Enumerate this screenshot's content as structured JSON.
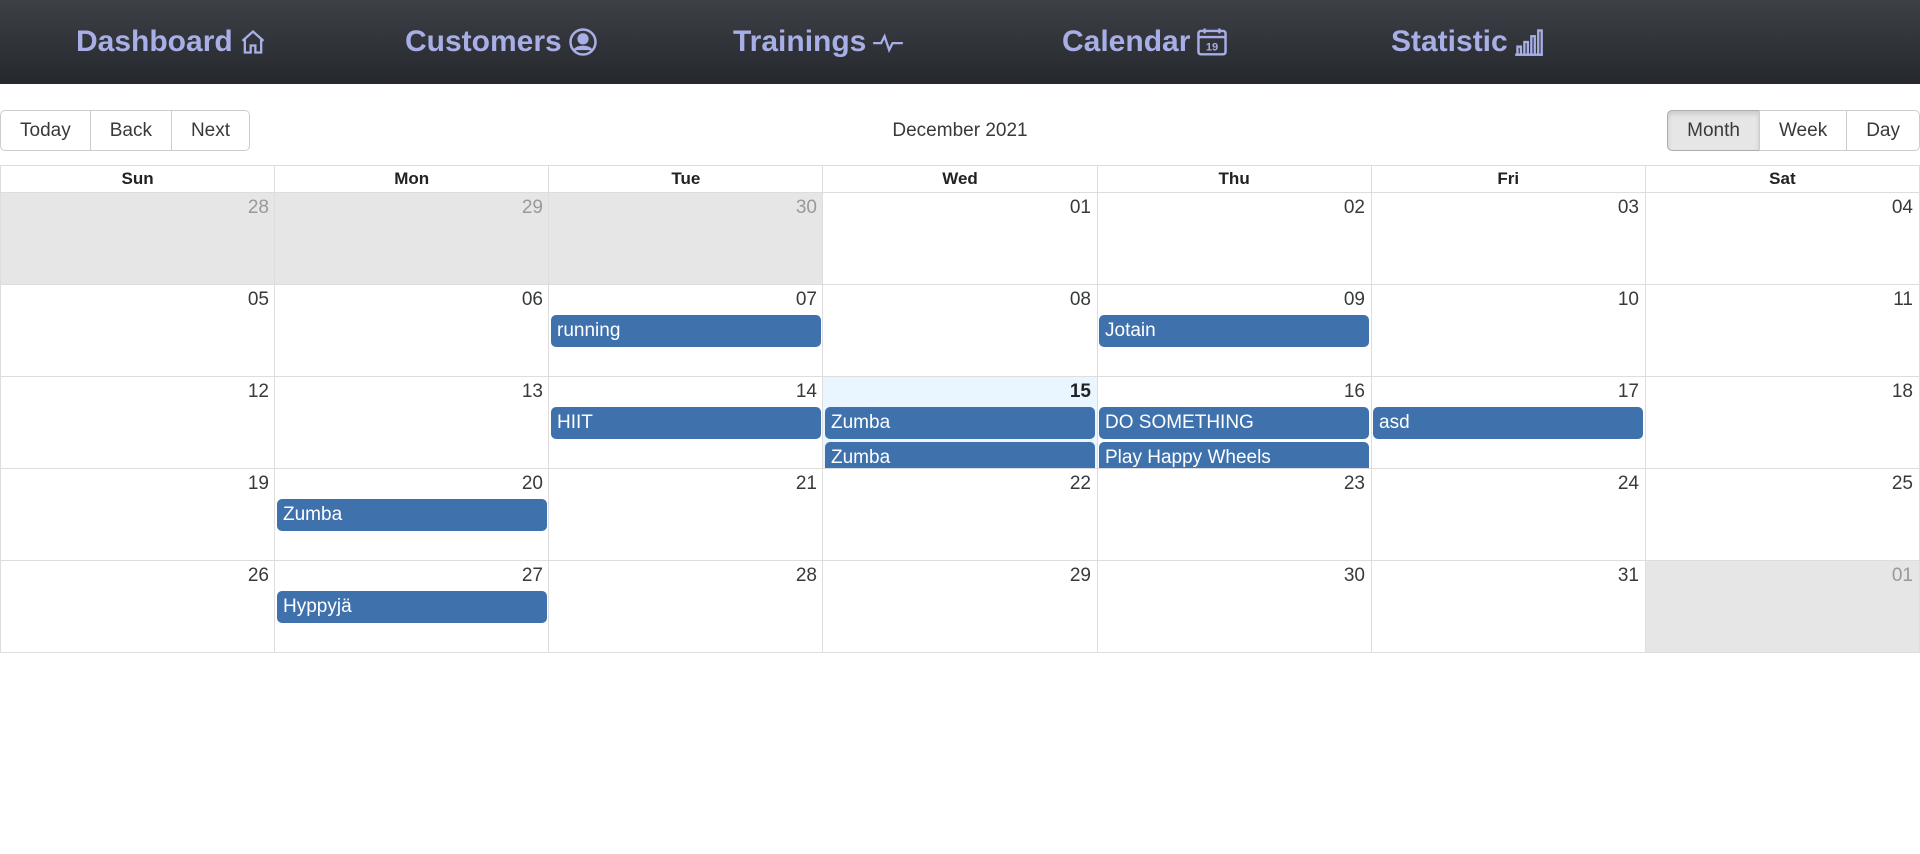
{
  "nav": {
    "dashboard": "Dashboard",
    "customers": "Customers",
    "trainings": "Trainings",
    "calendar": "Calendar",
    "calendar_icon_day": "19",
    "statistic": "Statistic"
  },
  "toolbar": {
    "today": "Today",
    "back": "Back",
    "next": "Next",
    "label": "December 2021",
    "month": "Month",
    "week": "Week",
    "day": "Day"
  },
  "weekdays": [
    "Sun",
    "Mon",
    "Tue",
    "Wed",
    "Thu",
    "Fri",
    "Sat"
  ],
  "weeks": [
    {
      "days": [
        {
          "date": "28",
          "off": true
        },
        {
          "date": "29",
          "off": true
        },
        {
          "date": "30",
          "off": true
        },
        {
          "date": "01"
        },
        {
          "date": "02"
        },
        {
          "date": "03"
        },
        {
          "date": "04"
        }
      ],
      "events": []
    },
    {
      "days": [
        {
          "date": "05"
        },
        {
          "date": "06"
        },
        {
          "date": "07"
        },
        {
          "date": "08"
        },
        {
          "date": "09"
        },
        {
          "date": "10"
        },
        {
          "date": "11"
        }
      ],
      "events": [
        {
          "title": "running",
          "day": 2,
          "slot": 0
        },
        {
          "title": "Jotain",
          "day": 4,
          "slot": 0
        }
      ]
    },
    {
      "days": [
        {
          "date": "12"
        },
        {
          "date": "13"
        },
        {
          "date": "14"
        },
        {
          "date": "15",
          "today": true
        },
        {
          "date": "16"
        },
        {
          "date": "17"
        },
        {
          "date": "18"
        }
      ],
      "events": [
        {
          "title": "HIIT",
          "day": 2,
          "slot": 0
        },
        {
          "title": "Zumba",
          "day": 3,
          "slot": 0
        },
        {
          "title": "Zumba",
          "day": 3,
          "slot": 1
        },
        {
          "title": "DO SOMETHING",
          "day": 4,
          "slot": 0
        },
        {
          "title": "Play Happy Wheels",
          "day": 4,
          "slot": 1
        },
        {
          "title": "asd",
          "day": 5,
          "slot": 0
        }
      ]
    },
    {
      "days": [
        {
          "date": "19"
        },
        {
          "date": "20"
        },
        {
          "date": "21"
        },
        {
          "date": "22"
        },
        {
          "date": "23"
        },
        {
          "date": "24"
        },
        {
          "date": "25"
        }
      ],
      "events": [
        {
          "title": "Zumba",
          "day": 1,
          "slot": 0
        }
      ]
    },
    {
      "days": [
        {
          "date": "26"
        },
        {
          "date": "27"
        },
        {
          "date": "28"
        },
        {
          "date": "29"
        },
        {
          "date": "30"
        },
        {
          "date": "31"
        },
        {
          "date": "01",
          "off": true
        }
      ],
      "events": [
        {
          "title": "Hyppyjä",
          "day": 1,
          "slot": 0
        }
      ]
    }
  ]
}
